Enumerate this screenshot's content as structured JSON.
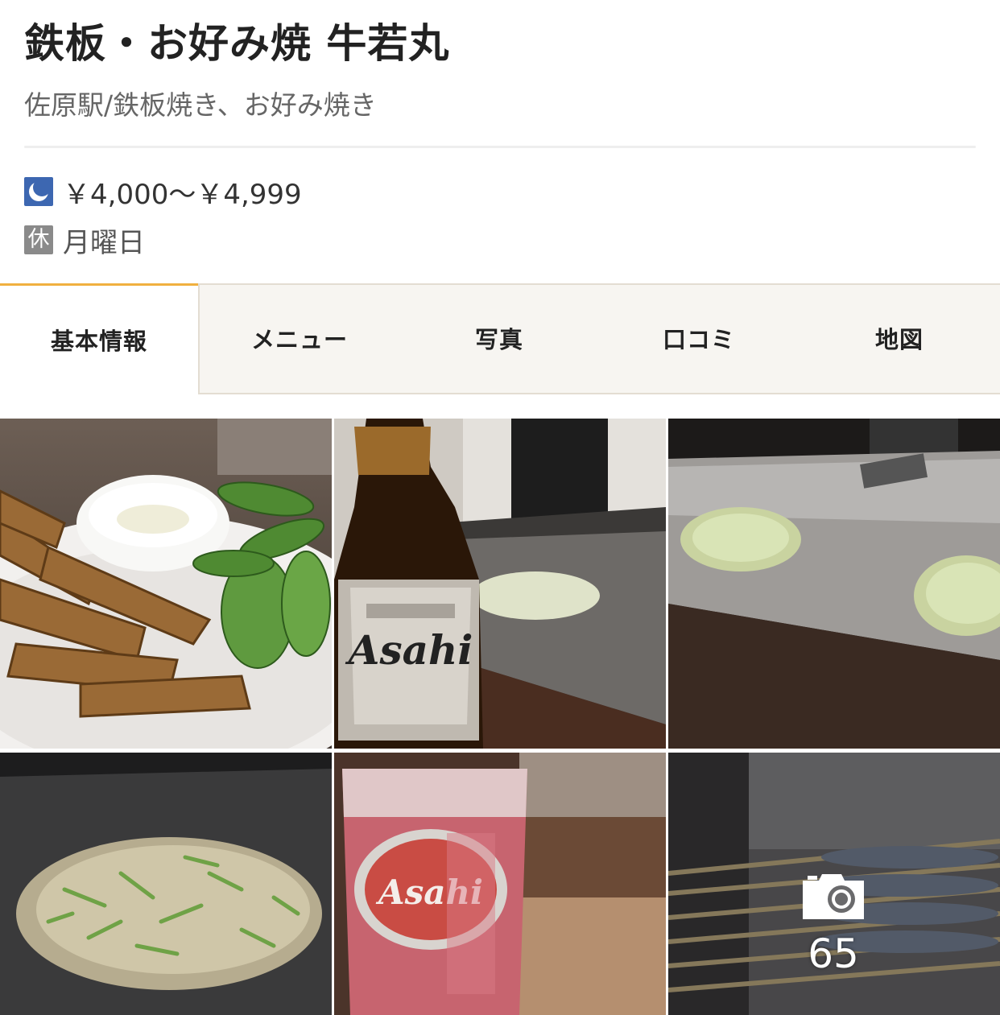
{
  "restaurant": {
    "name": "鉄板・お好み焼 牛若丸",
    "station_genre": "佐原駅/鉄板焼き、お好み焼き",
    "dinner_price": "￥4,000～￥4,999",
    "closed_label": "休",
    "closed_day": "月曜日"
  },
  "tabs": [
    {
      "label": "基本情報",
      "active": true
    },
    {
      "label": "メニュー",
      "active": false
    },
    {
      "label": "写真",
      "active": false
    },
    {
      "label": "口コミ",
      "active": false
    },
    {
      "label": "地図",
      "active": false
    }
  ],
  "photos": {
    "items": [
      {
        "subject": "fried fish strips and edamame plate"
      },
      {
        "subject": "Asahi beer bottle at teppan counter"
      },
      {
        "subject": "okonomiyaki on teppan griddle"
      },
      {
        "subject": "okonomiyaki close-up with green onions"
      },
      {
        "subject": "red sour drink in Asahi glass"
      },
      {
        "subject": "skewers on counter"
      }
    ],
    "count": "65",
    "camera_icon": "camera-icon"
  },
  "colors": {
    "tab_accent": "#f0b03f",
    "moon_badge": "#3d67b1",
    "closed_badge": "#8a8a8a"
  }
}
